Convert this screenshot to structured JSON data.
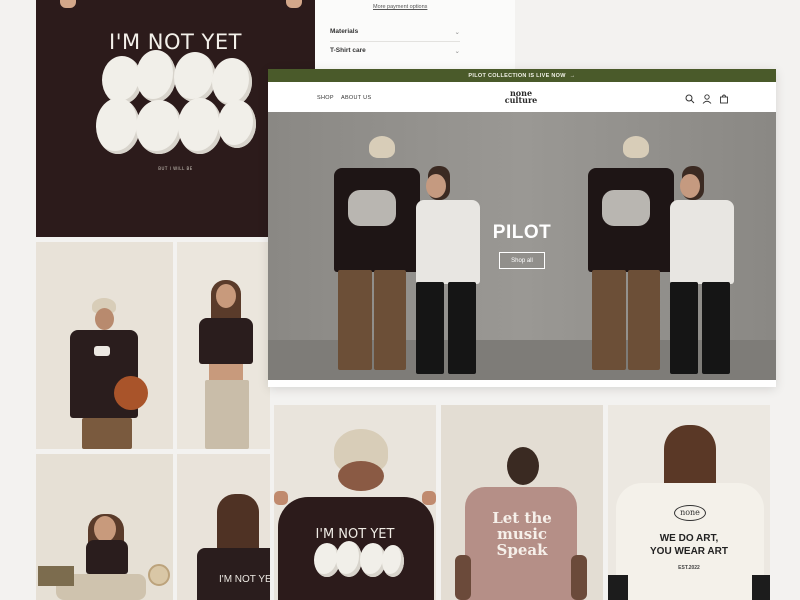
{
  "pdp": {
    "payment_link": "More payment options",
    "rows": [
      {
        "label": "Materials",
        "chevron": "⌄"
      },
      {
        "label": "T-Shirt care",
        "chevron": "⌄"
      }
    ]
  },
  "store": {
    "announcement": "PILOT COLLECTION IS LIVE NOW",
    "announcement_arrow": "→",
    "nav": [
      {
        "label": "SHOP"
      },
      {
        "label": "ABOUT US"
      }
    ],
    "logo_line1": "none",
    "logo_line2": "culture",
    "hero_title": "PILOT",
    "hero_button": "Shop all"
  },
  "shirts": {
    "main_print": "I'M NOT YET",
    "main_sub": "BUT I WILL BE",
    "chest_logo": "none",
    "back_print_small": "I'M NOT YE",
    "music_line1": "Let the",
    "music_line2": "music",
    "music_line3": "Speak",
    "art_logo": "none",
    "art_line1": "WE DO ART,",
    "art_line2": "YOU WEAR ART",
    "art_est": "EST.2022"
  },
  "colors": {
    "announcement_bg": "#4a5a2a",
    "shirt_brown": "#2c1b1b",
    "shirt_pink": "#b58f87",
    "shirt_cream": "#f4f1ea"
  },
  "icons": [
    "search-icon",
    "account-icon",
    "cart-icon",
    "chevron-down-icon",
    "arrow-right-icon"
  ]
}
